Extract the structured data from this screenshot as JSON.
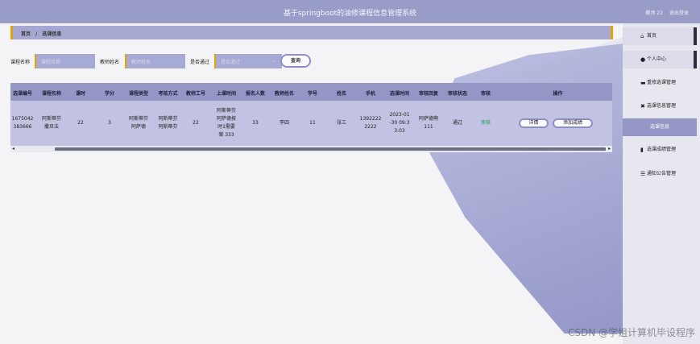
{
  "header": {
    "title": "基于springboot的油修课程信息管理系统",
    "user_label": "教师 22",
    "logout_label": "退出登录"
  },
  "breadcrumb": {
    "home": "首页",
    "separator": "/",
    "current": "选课信息"
  },
  "search": {
    "course_name_label": "课程名称",
    "course_name_placeholder": "课程名称",
    "teacher_name_label": "教师姓名",
    "teacher_name_placeholder": "教师姓名",
    "passed_label": "是否通过",
    "passed_placeholder": "是否通过",
    "search_button": "查询"
  },
  "table": {
    "columns": [
      "选课编号",
      "课程名称",
      "课时",
      "学分",
      "课程类型",
      "考核方式",
      "教师工号",
      "上课时间",
      "报名人数",
      "教师姓名",
      "学号",
      "姓名",
      "手机",
      "选课时间",
      "审核回复",
      "审核状态",
      "审核",
      "操作"
    ],
    "row": {
      "id_line1": "1675042",
      "id_line2": "383666",
      "course_line1": "阿斯蒂芬",
      "course_line2": "撒旦法",
      "hours": "22",
      "credits": "3",
      "type_line1": "阿斯蒂芬",
      "type_line2": "阿萨德",
      "exam_line1": "阿斯蒂芬",
      "exam_line2": "阿斯蒂芬",
      "teacher_no": "22",
      "time_line1": "阿斯蒂芬",
      "time_line2": "阿萨德按",
      "time_line3": "时1需要",
      "time_line4": "案 333",
      "enrolled": "33",
      "teacher_name": "李四",
      "student_no": "11",
      "student_name": "张三",
      "phone_line1": "1392222",
      "phone_line2": "2222",
      "date_line1": "2023-01",
      "date_line2": "-30 09:3",
      "date_line3": "3:03",
      "reply_line1": "阿萨德啊",
      "reply_line2": "111",
      "review_status": "通过",
      "review_link": "审核",
      "detail_button": "详情",
      "grade_button": "添加成绩"
    }
  },
  "sidebar": {
    "items": [
      {
        "label": "首页",
        "icon": "home-icon"
      },
      {
        "label": "个人中心",
        "icon": "user-icon"
      },
      {
        "label": "重修选课管理",
        "icon": "book-icon"
      },
      {
        "label": "选课信息管理",
        "icon": "grid-icon"
      },
      {
        "label": "选课信息",
        "icon": ""
      },
      {
        "label": "选课成绩管理",
        "icon": "file-icon"
      },
      {
        "label": "通知公告管理",
        "icon": "list-icon"
      }
    ]
  },
  "watermark": "CSDN @学姐计算机毕设程序",
  "colors": {
    "header": "#9a9cc8",
    "accent": "#e0a400",
    "row": "#c2c3e2",
    "status_green": "#1b9f5c"
  }
}
